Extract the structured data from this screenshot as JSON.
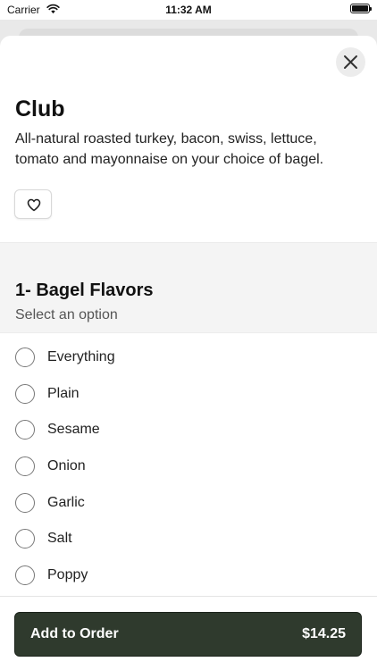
{
  "status_bar": {
    "carrier": "Carrier",
    "time": "11:32 AM"
  },
  "item": {
    "title": "Club",
    "description": "All-natural roasted turkey, bacon, swiss, lettuce, tomato and mayonnaise on your choice of bagel."
  },
  "section": {
    "title": "1- Bagel Flavors",
    "subtitle": "Select an option"
  },
  "options": [
    "Everything",
    "Plain",
    "Sesame",
    "Onion",
    "Garlic",
    "Salt",
    "Poppy"
  ],
  "footer": {
    "add_label": "Add to Order",
    "price": "$14.25"
  },
  "icons": {
    "close": "close-icon",
    "favorite": "heart-icon",
    "wifi": "wifi-icon",
    "battery": "battery-icon"
  },
  "colors": {
    "button_bg": "#2f3a2d",
    "section_bg": "#f4f4f4"
  }
}
